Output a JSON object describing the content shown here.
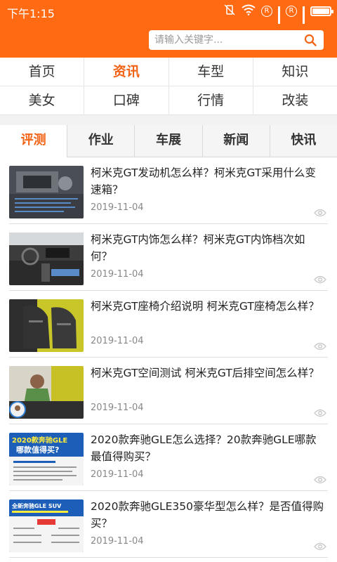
{
  "status_bar": {
    "time": "下午1:15"
  },
  "search": {
    "placeholder": "请输入关键字..."
  },
  "categories": [
    {
      "label": "首页"
    },
    {
      "label": "资讯"
    },
    {
      "label": "车型"
    },
    {
      "label": "知识"
    },
    {
      "label": "美女"
    },
    {
      "label": "口碑"
    },
    {
      "label": "行情"
    },
    {
      "label": "改装"
    }
  ],
  "tabs": [
    {
      "label": "评测"
    },
    {
      "label": "作业"
    },
    {
      "label": "车展"
    },
    {
      "label": "新闻"
    },
    {
      "label": "快讯"
    }
  ],
  "articles": [
    {
      "title": "柯米克GT发动机怎么样？柯米克GT采用什么变速箱？",
      "date": "2019-11-04"
    },
    {
      "title": "柯米克GT内饰怎么样？柯米克GT内饰档次如何？",
      "date": "2019-11-04"
    },
    {
      "title": "柯米克GT座椅介绍说明 柯米克GT座椅怎么样？",
      "date": "2019-11-04"
    },
    {
      "title": "柯米克GT空间测试 柯米克GT后排空间怎么样？",
      "date": "2019-11-04"
    },
    {
      "title": "2020款奔驰GLE怎么选择？20款奔驰GLE哪款最值得购买？",
      "date": "2019-11-04"
    },
    {
      "title": "2020款奔驰GLE350豪华型怎么样？是否值得购买？",
      "date": "2019-11-04"
    }
  ],
  "thumb_text": {
    "t5_line1": "2020款奔驰GLE",
    "t5_line2": "哪款值得买?",
    "t6_line1": "全新奔驰GLE SUV"
  },
  "colors": {
    "accent": "#ff6a13",
    "active_text": "#f26316"
  }
}
